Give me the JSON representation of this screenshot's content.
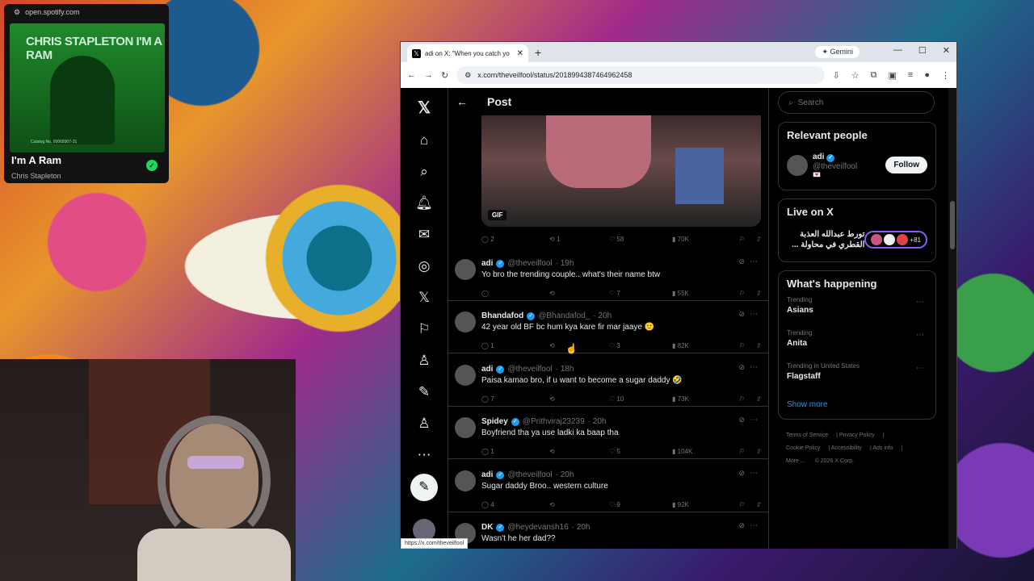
{
  "spotify": {
    "url": "open.spotify.com",
    "album_title_art": "CHRIS STAPLETON I'M A RAM",
    "album_fine_print": "Catalog No. 00068907-31",
    "track": "I'm A Ram",
    "artist": "Chris Stapleton"
  },
  "browser": {
    "tab_title": "adi on X: \"When you catch yo",
    "new_tab": "+",
    "gemini": "Gemini",
    "url": "x.com/theveilfool/status/2018994387464962458",
    "status_url": "https://x.com/theveilfool"
  },
  "header": {
    "title": "Post"
  },
  "media": {
    "badge": "GIF",
    "replies": "2",
    "reposts": "1",
    "likes": "58",
    "views": "70K"
  },
  "replies": [
    {
      "name": "adi",
      "handle": "@theveilfool",
      "time": "· 19h",
      "text": "Yo bro the trending couple.. what's their name btw",
      "replies": "",
      "reposts": "",
      "likes": "7",
      "views": "55K"
    },
    {
      "name": "Bhandafod",
      "handle": "@Bhandafod_",
      "time": "· 20h",
      "text": "42 year old BF bc hum kya kare fir mar jaaye 🙂",
      "replies": "1",
      "reposts": "",
      "likes": "3",
      "views": "82K"
    },
    {
      "name": "adi",
      "handle": "@theveilfool",
      "time": "· 18h",
      "text": "Paisa kamao bro, if u want to become a sugar daddy 🤣",
      "replies": "7",
      "reposts": "",
      "likes": "10",
      "views": "73K"
    },
    {
      "name": "Spidey",
      "handle": "@Prithviraj23239",
      "time": "· 20h",
      "text": "Boyfriend tha ya use ladki ka baap tha",
      "replies": "1",
      "reposts": "",
      "likes": "5",
      "views": "104K"
    },
    {
      "name": "adi",
      "handle": "@theveilfool",
      "time": "· 20h",
      "text": "Sugar daddy Broo.. western culture",
      "replies": "4",
      "reposts": "",
      "likes": "9",
      "views": "92K"
    },
    {
      "name": "DK",
      "handle": "@heydevansh16",
      "time": "· 20h",
      "text": "Wasn't he her dad??",
      "replies": "",
      "reposts": "",
      "likes": "",
      "views": ""
    }
  ],
  "sidebar": {
    "search_placeholder": "Search",
    "relevant_title": "Relevant people",
    "person_name": "adi",
    "person_handle": "@theveilfool",
    "person_bio": "💌",
    "follow_label": "Follow",
    "live_title": "Live on X",
    "live_text": "تورط عبدالله العذبة القطري في محاولة ...",
    "live_count": "+81",
    "happening_title": "What's happening",
    "trends": [
      {
        "label": "Trending",
        "name": "Asians"
      },
      {
        "label": "Trending",
        "name": "Anita"
      },
      {
        "label": "Trending in United States",
        "name": "Flagstaff"
      }
    ],
    "show_more": "Show more",
    "footer": [
      "Terms of Service",
      "Privacy Policy",
      "Cookie Policy",
      "Accessibility",
      "Ads info",
      "More ...",
      "© 2026 X Corp."
    ]
  },
  "colors": {
    "accent": "#1d9bf0",
    "bg": "#000000",
    "spotify_green": "#1ed760"
  }
}
